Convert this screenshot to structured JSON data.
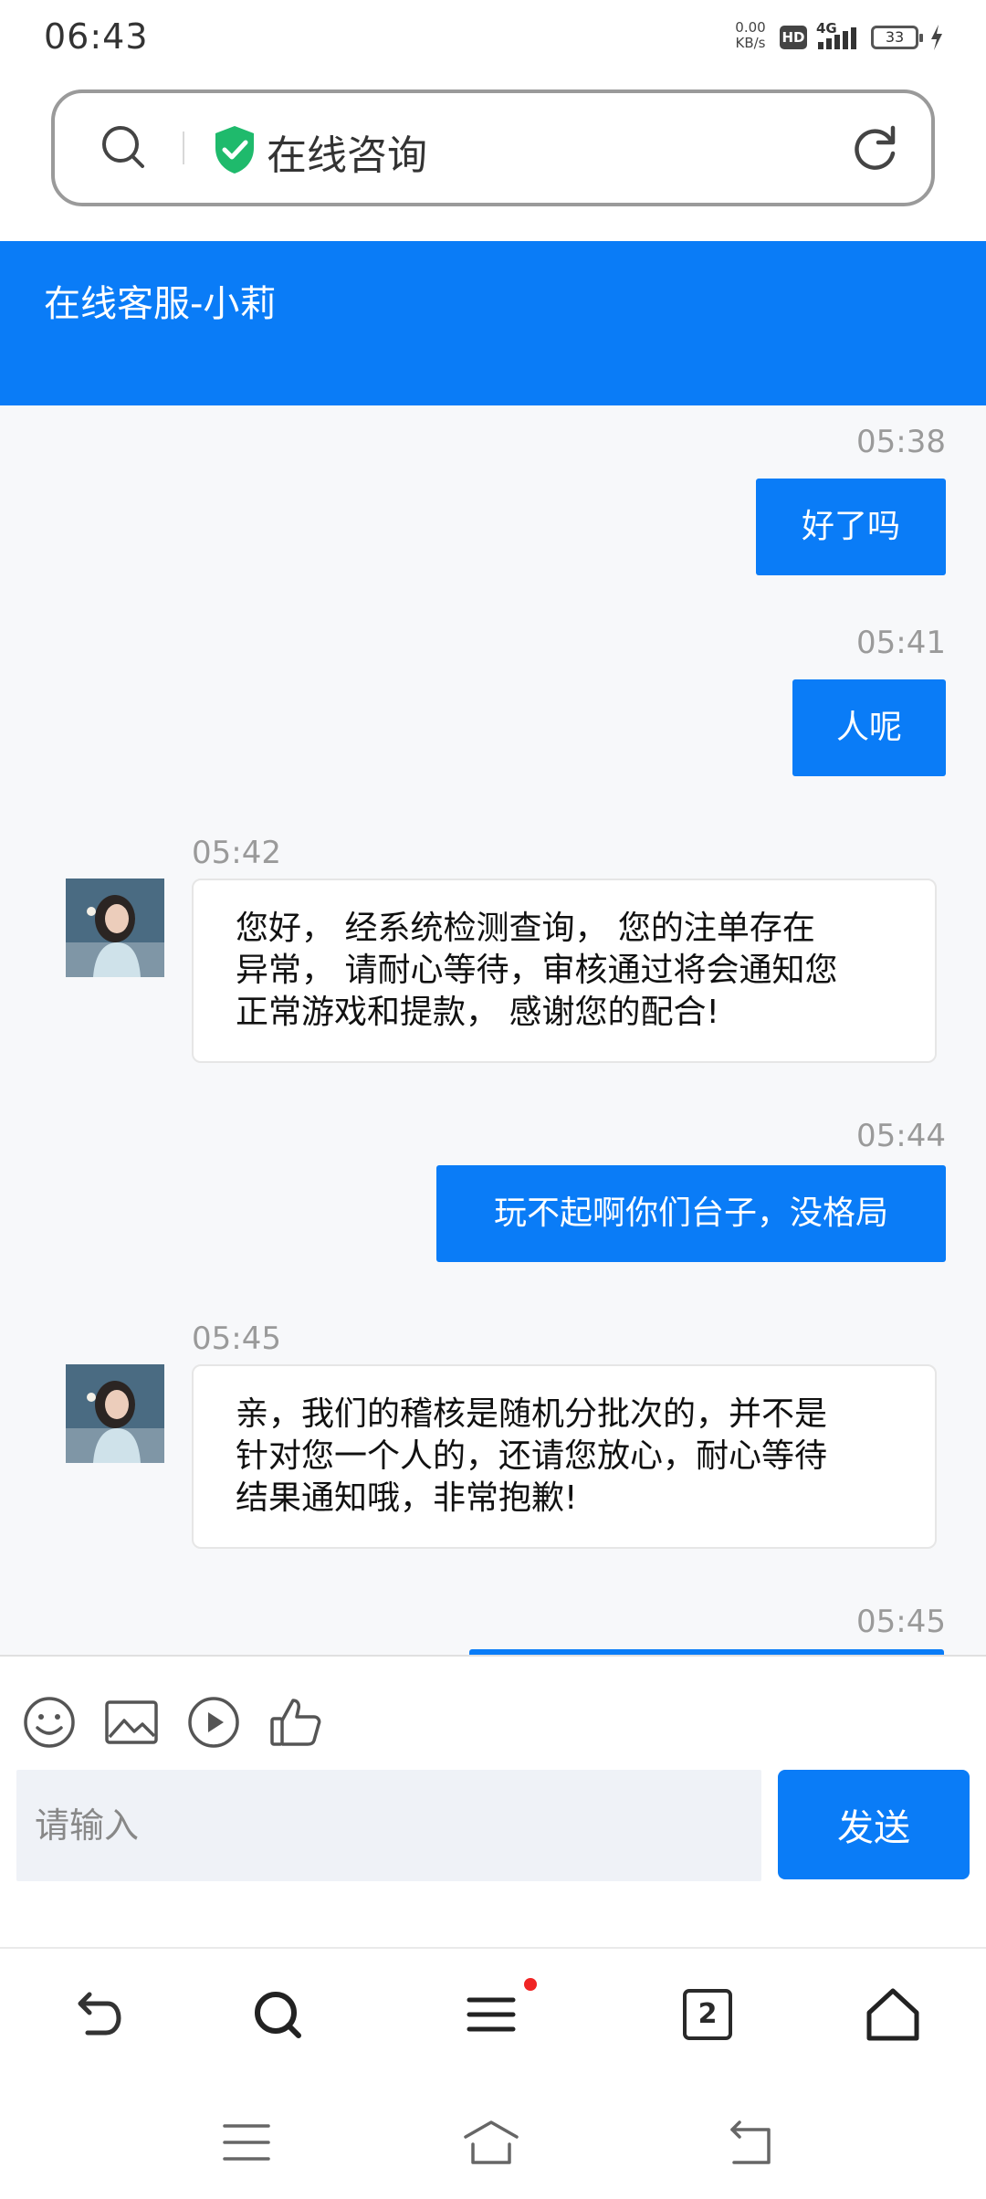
{
  "status_bar": {
    "time": "06:43",
    "net_speed_value": "0.00",
    "net_speed_unit": "KB/s",
    "hd": "HD",
    "network": "4G",
    "battery": "33"
  },
  "url_bar": {
    "title": "在线咨询"
  },
  "chat_header": {
    "title": "在线客服-小莉"
  },
  "messages": [
    {
      "side": "out",
      "time": "05:38",
      "text": "好了吗"
    },
    {
      "side": "out",
      "time": "05:41",
      "text": "人呢"
    },
    {
      "side": "in",
      "time": "05:42",
      "lines": [
        "您好， 经系统检测查询， 您的注单存在",
        "异常， 请耐心等待，审核通过将会通知您",
        "正常游戏和提款， 感谢您的配合!"
      ]
    },
    {
      "side": "out",
      "time": "05:44",
      "text": "玩不起啊你们台子，没格局"
    },
    {
      "side": "in",
      "time": "05:45",
      "lines": [
        "亲，我们的稽核是随机分批次的，并不是",
        "针对您一个人的，还请您放心，耐心等待",
        "结果通知哦，非常抱歉!"
      ]
    },
    {
      "side": "out",
      "time": "05:45",
      "text": ""
    }
  ],
  "input": {
    "placeholder": "请输入",
    "send_label": "发送"
  },
  "toolbar": {
    "tab_count": "2"
  },
  "colors": {
    "accent": "#0a7cf7",
    "notification_dot": "#f02424"
  },
  "icons": [
    "search-icon",
    "shield-check-icon",
    "reload-icon",
    "emoji-icon",
    "image-icon",
    "video-icon",
    "thumbs-up-icon",
    "back-icon",
    "search-icon",
    "menu-icon",
    "tabs-icon",
    "home-icon"
  ]
}
